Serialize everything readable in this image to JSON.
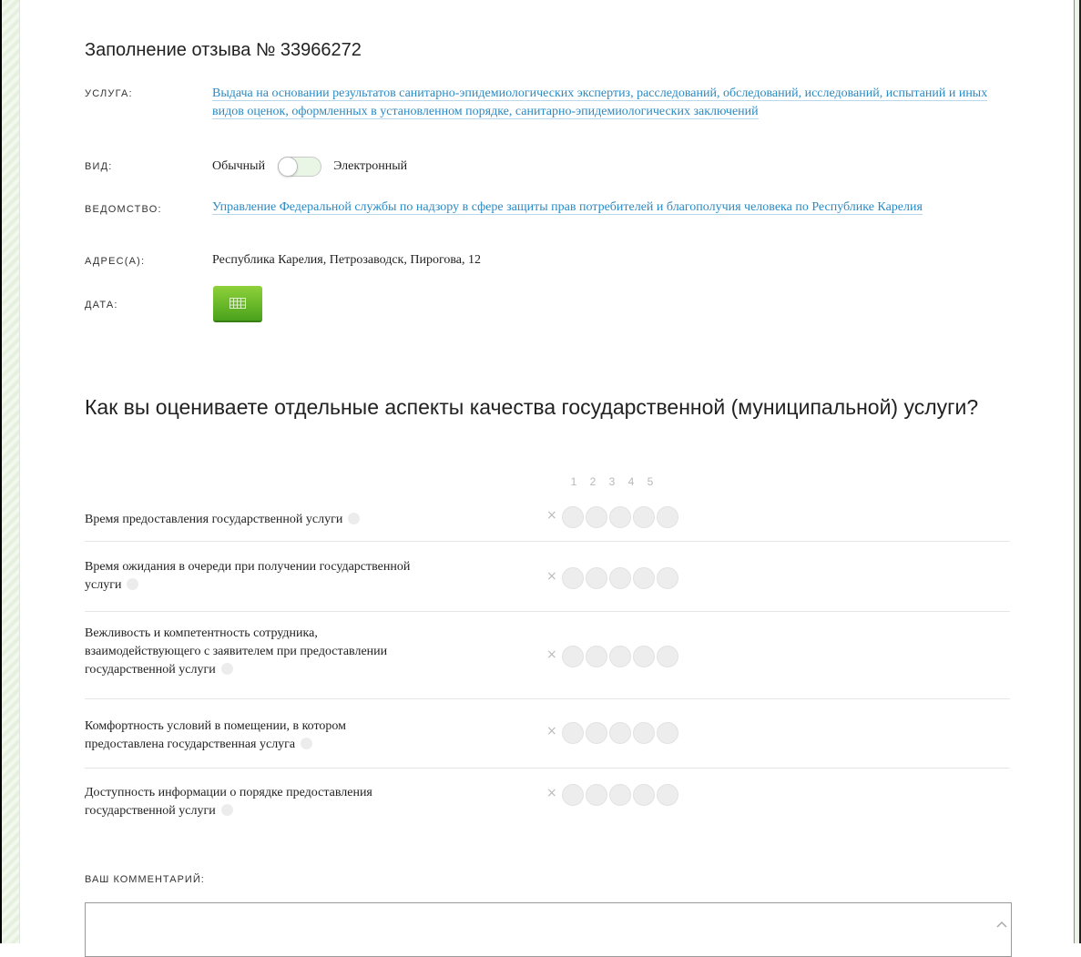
{
  "form": {
    "title": "Заполнение отзыва № 33966272",
    "service_label": "УСЛУГА:",
    "service_value": "Выдача на основании результатов санитарно-эпидемиологических экспертиз, расследований, обследований, исследований, испытаний и иных видов оценок, оформленных в установленном порядке, санитарно-эпидемиологических заключений",
    "type_label": "ВИД:",
    "type_option_regular": "Обычный",
    "type_option_electronic": "Электронный",
    "type_selected": "Обычный",
    "agency_label": "ВЕДОМСТВО:",
    "agency_value": "Управление Федеральной службы по надзору в сфере защиты прав потребителей и благополучия человека по Республике Карелия",
    "address_label": "АДРЕС(А):",
    "address_value": "Республика Карелия, Петрозаводск, Пирогова, 12",
    "date_label": "ДАТА:"
  },
  "rating": {
    "title": "Как вы оцениваете отдельные аспекты качества государственной (муниципальной) услуги?",
    "scale": [
      "1",
      "2",
      "3",
      "4",
      "5"
    ],
    "clear_symbol": "×",
    "questions": [
      {
        "text": "Время предоставления государственной услуги",
        "value": 0
      },
      {
        "text": "Время ожидания в очереди при получении государственной услуги",
        "value": 0
      },
      {
        "text": "Вежливость и компетентность сотрудника, взаимодействующего с заявителем при предоставлении государственной услуги",
        "value": 0
      },
      {
        "text": "Комфортность условий в помещении, в котором предоставлена государственная услуга",
        "value": 0
      },
      {
        "text": "Доступность информации о порядке предоставления государственной услуги",
        "value": 0
      }
    ]
  },
  "comment": {
    "label": "ВАШ КОММЕНТАРИЙ:",
    "value": ""
  },
  "colors": {
    "link": "#2a8ac4",
    "button_green": "#5cb82a",
    "toggle_bg": "#e9f6e6"
  },
  "icons": {
    "date_button": "calendar-icon",
    "hint": "info-icon",
    "scroll": "chevron-up-icon"
  }
}
